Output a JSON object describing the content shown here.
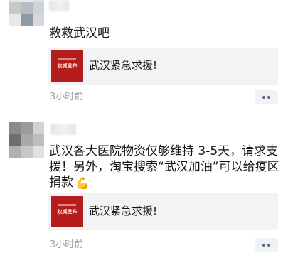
{
  "colors": {
    "background": "#ffffff",
    "card_background": "#f3f3f5",
    "thumbnail_red": "#b51d1d",
    "timestamp_gray": "#a1a1a1",
    "more_dots": "#5d6a8a"
  },
  "posts": [
    {
      "text": "救救武汉吧",
      "link_card": {
        "thumbnail_caption": "权威发布",
        "title": "武汉紧急求援!"
      },
      "time": "3小时前",
      "more_icon": "more-dots-icon"
    },
    {
      "text": "武汉各大医院物资仅够维持 3-5天，请求支援！另外，淘宝搜索“武汉加油”可以给疫区捐款",
      "emoji": "💪",
      "link_card": {
        "thumbnail_caption": "权威发布",
        "title": "武汉紧急求援!"
      },
      "time": "3小时前",
      "more_icon": "more-dots-icon"
    }
  ]
}
